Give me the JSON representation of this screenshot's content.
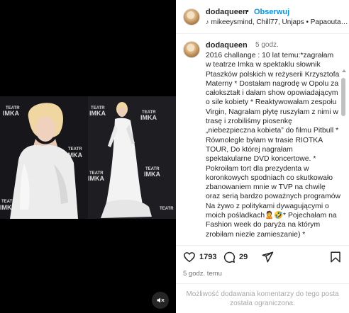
{
  "header": {
    "username": "dodaqueen",
    "separator": "•",
    "follow_label": "Obserwuj",
    "audio_text": "mikeeysmind, Chill77, Unjaps • Papaouta…"
  },
  "caption": {
    "username": "dodaqueen",
    "time": "5 godz.",
    "text": "2016 challange : 10 lat temu:*zagrałam w teatrze Imka  w spektaklu słownik Ptaszków polskich w reżyserii Krzysztofa Materny * Dostałam nagrodę  w Opolu za całokształt i dałam show opowiadającym o sile kobiety * Reaktywowałam zespołu Virgin, Nagrałam płytę ruszyłam z nimi w trasę i zrobiliśmy piosenkę „niebezpieczna kobieta” do filmu Pitbull * Równolegle byłam w trasie RIOTKA TOUR, Do której nagrałam spektakularne DVD koncertowe. * Pokroiłam tort dla prezydenta w koronkowych spodniach co skutkowało zbanowaniem mnie w TVP na chwilę oraz serią bardzo poważnych programów Na żywo z politykami dywagującymi o moich pośladkach🙎🤣* Pojechałam na Fashion week do paryża na którym zrobiłam niezłe zamieszanie) *"
  },
  "actions": {
    "like_count": "1793",
    "comment_count": "29",
    "post_time": "5 godz. temu"
  },
  "comments_disabled_text": "Możliwość dodawania komentarzy do tego posta została ograniczona.",
  "media": {
    "backdrop_text": [
      "TEATR",
      "IMKA"
    ]
  },
  "icons": {
    "like": "heart-icon",
    "comment": "comment-icon",
    "share": "send-icon",
    "save": "bookmark-icon",
    "mute": "speaker-muted-icon",
    "audio": "music-note-icon"
  },
  "colors": {
    "accent": "#0095f6",
    "text": "#262626",
    "muted": "#737373",
    "media_bg": "#000000"
  }
}
